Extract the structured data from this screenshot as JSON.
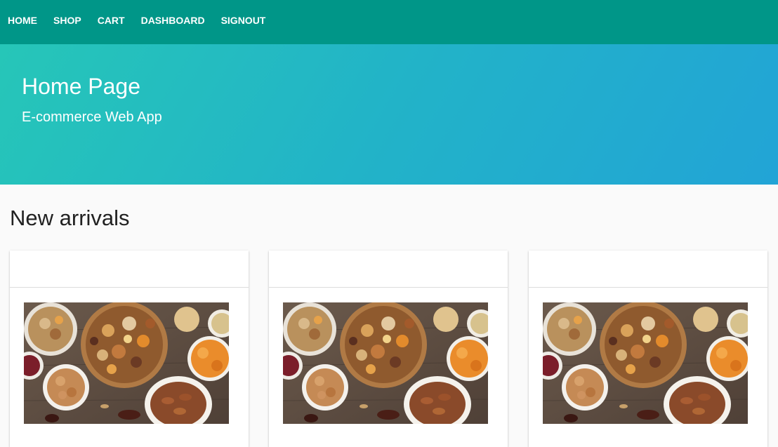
{
  "navbar": {
    "links": [
      {
        "label": "HOME"
      },
      {
        "label": "SHOP"
      },
      {
        "label": "CART"
      },
      {
        "label": "DASHBOARD"
      },
      {
        "label": "SIGNOUT"
      }
    ]
  },
  "hero": {
    "title": "Home Page",
    "subtitle": "E-commerce Web App"
  },
  "new_arrivals": {
    "heading": "New arrivals",
    "cards": [
      {
        "header": "",
        "image": "dried-fruits-nuts-photo"
      },
      {
        "header": "",
        "image": "dried-fruits-nuts-photo"
      },
      {
        "header": "",
        "image": "dried-fruits-nuts-photo"
      }
    ]
  },
  "colors": {
    "navbar": "#009688",
    "hero_start": "#26c6b8",
    "hero_end": "#22a4d6"
  }
}
